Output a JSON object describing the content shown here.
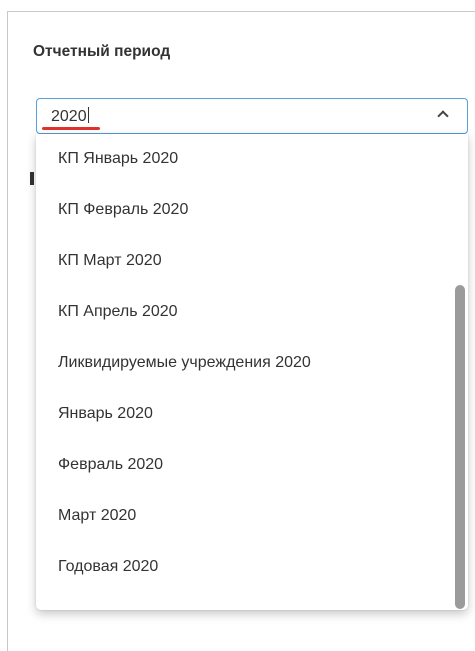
{
  "section": {
    "title": "Отчетный период"
  },
  "select": {
    "value": "2020",
    "chevron_icon": "chevron-up-icon",
    "expanded": true
  },
  "dropdown": {
    "options": [
      "КП Январь 2020",
      "КП Февраль 2020",
      "КП Март 2020",
      "КП Апрель 2020",
      "Ликвидируемые учреждения 2020",
      "Январь 2020",
      "Февраль 2020",
      "Март 2020",
      "Годовая 2020"
    ]
  },
  "colors": {
    "focus_border": "#5a9fd8",
    "annotation_underline": "#e0322d",
    "scrollbar_thumb": "#9b9b9b"
  }
}
